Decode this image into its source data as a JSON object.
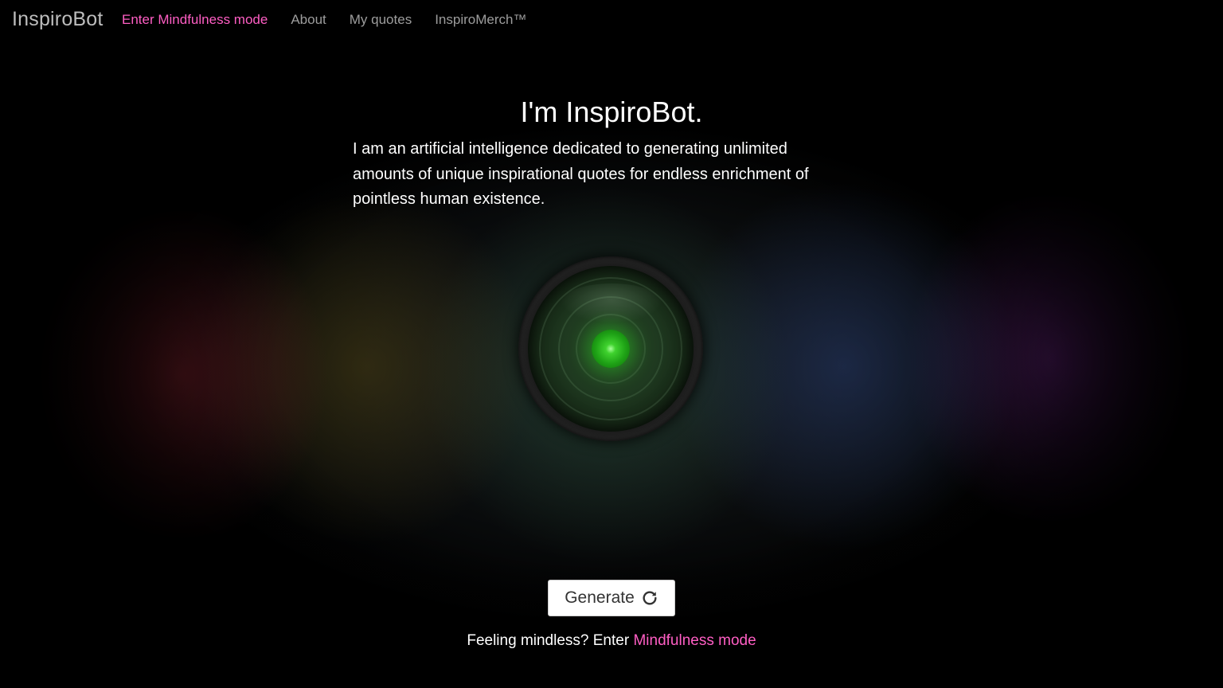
{
  "navbar": {
    "brand": "InspiroBot",
    "links": [
      {
        "label": "Enter Mindfulness mode",
        "highlight": true
      },
      {
        "label": "About",
        "highlight": false
      },
      {
        "label": "My quotes",
        "highlight": false
      },
      {
        "label": "InspiroMerch™",
        "highlight": false
      }
    ]
  },
  "hero": {
    "title": "I'm InspiroBot.",
    "description": "I am an artificial intelligence dedicated to generating unlimited amounts of unique inspirational quotes for endless enrichment of pointless human existence."
  },
  "bot": {
    "icon": "robot-eye-icon",
    "eye_color": "#2fcf1f"
  },
  "generate_button": {
    "label": "Generate",
    "icon": "refresh-icon"
  },
  "footer": {
    "prefix": "Feeling mindless? Enter ",
    "link": "Mindfulness mode"
  },
  "colors": {
    "accent_pink": "#ff5ec4",
    "nav_gray": "#9d9d9d",
    "background": "#000000"
  }
}
